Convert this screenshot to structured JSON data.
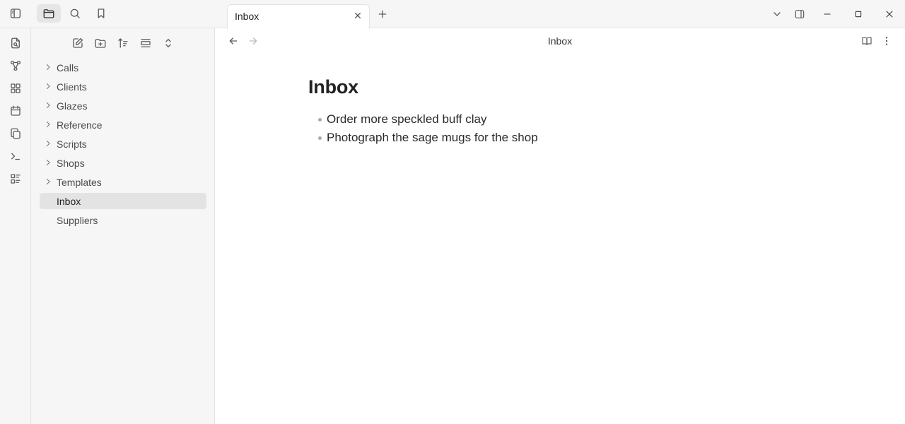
{
  "ribbon": {
    "icons": [
      "file-search-icon",
      "graph-view-icon",
      "canvas-icon",
      "calendar-icon",
      "copy-files-icon",
      "terminal-icon",
      "list-icon"
    ]
  },
  "sidebar": {
    "top_icons": [
      "sidebar-toggle-icon",
      "folder-icon",
      "search-icon",
      "bookmark-icon"
    ],
    "nav_actions": [
      "new-note-icon",
      "new-folder-icon",
      "sort-icon",
      "collapse-icon",
      "expand-all-icon"
    ],
    "tree": [
      {
        "label": "Calls",
        "folder": true
      },
      {
        "label": "Clients",
        "folder": true
      },
      {
        "label": "Glazes",
        "folder": true
      },
      {
        "label": "Reference",
        "folder": true
      },
      {
        "label": "Scripts",
        "folder": true
      },
      {
        "label": "Shops",
        "folder": true
      },
      {
        "label": "Templates",
        "folder": true
      },
      {
        "label": "Inbox",
        "folder": false,
        "active": true
      },
      {
        "label": "Suppliers",
        "folder": false
      }
    ]
  },
  "tabs": [
    {
      "title": "Inbox"
    }
  ],
  "view": {
    "title": "Inbox"
  },
  "document": {
    "heading": "Inbox",
    "bullets": [
      "Order more speckled buff clay",
      "Photograph the sage mugs for the shop"
    ]
  },
  "colors": {
    "sidebar_bg": "#f6f6f6",
    "active_item_bg": "#e3e3e3",
    "border": "#e3e3e3",
    "icon": "#5c5c5c"
  }
}
